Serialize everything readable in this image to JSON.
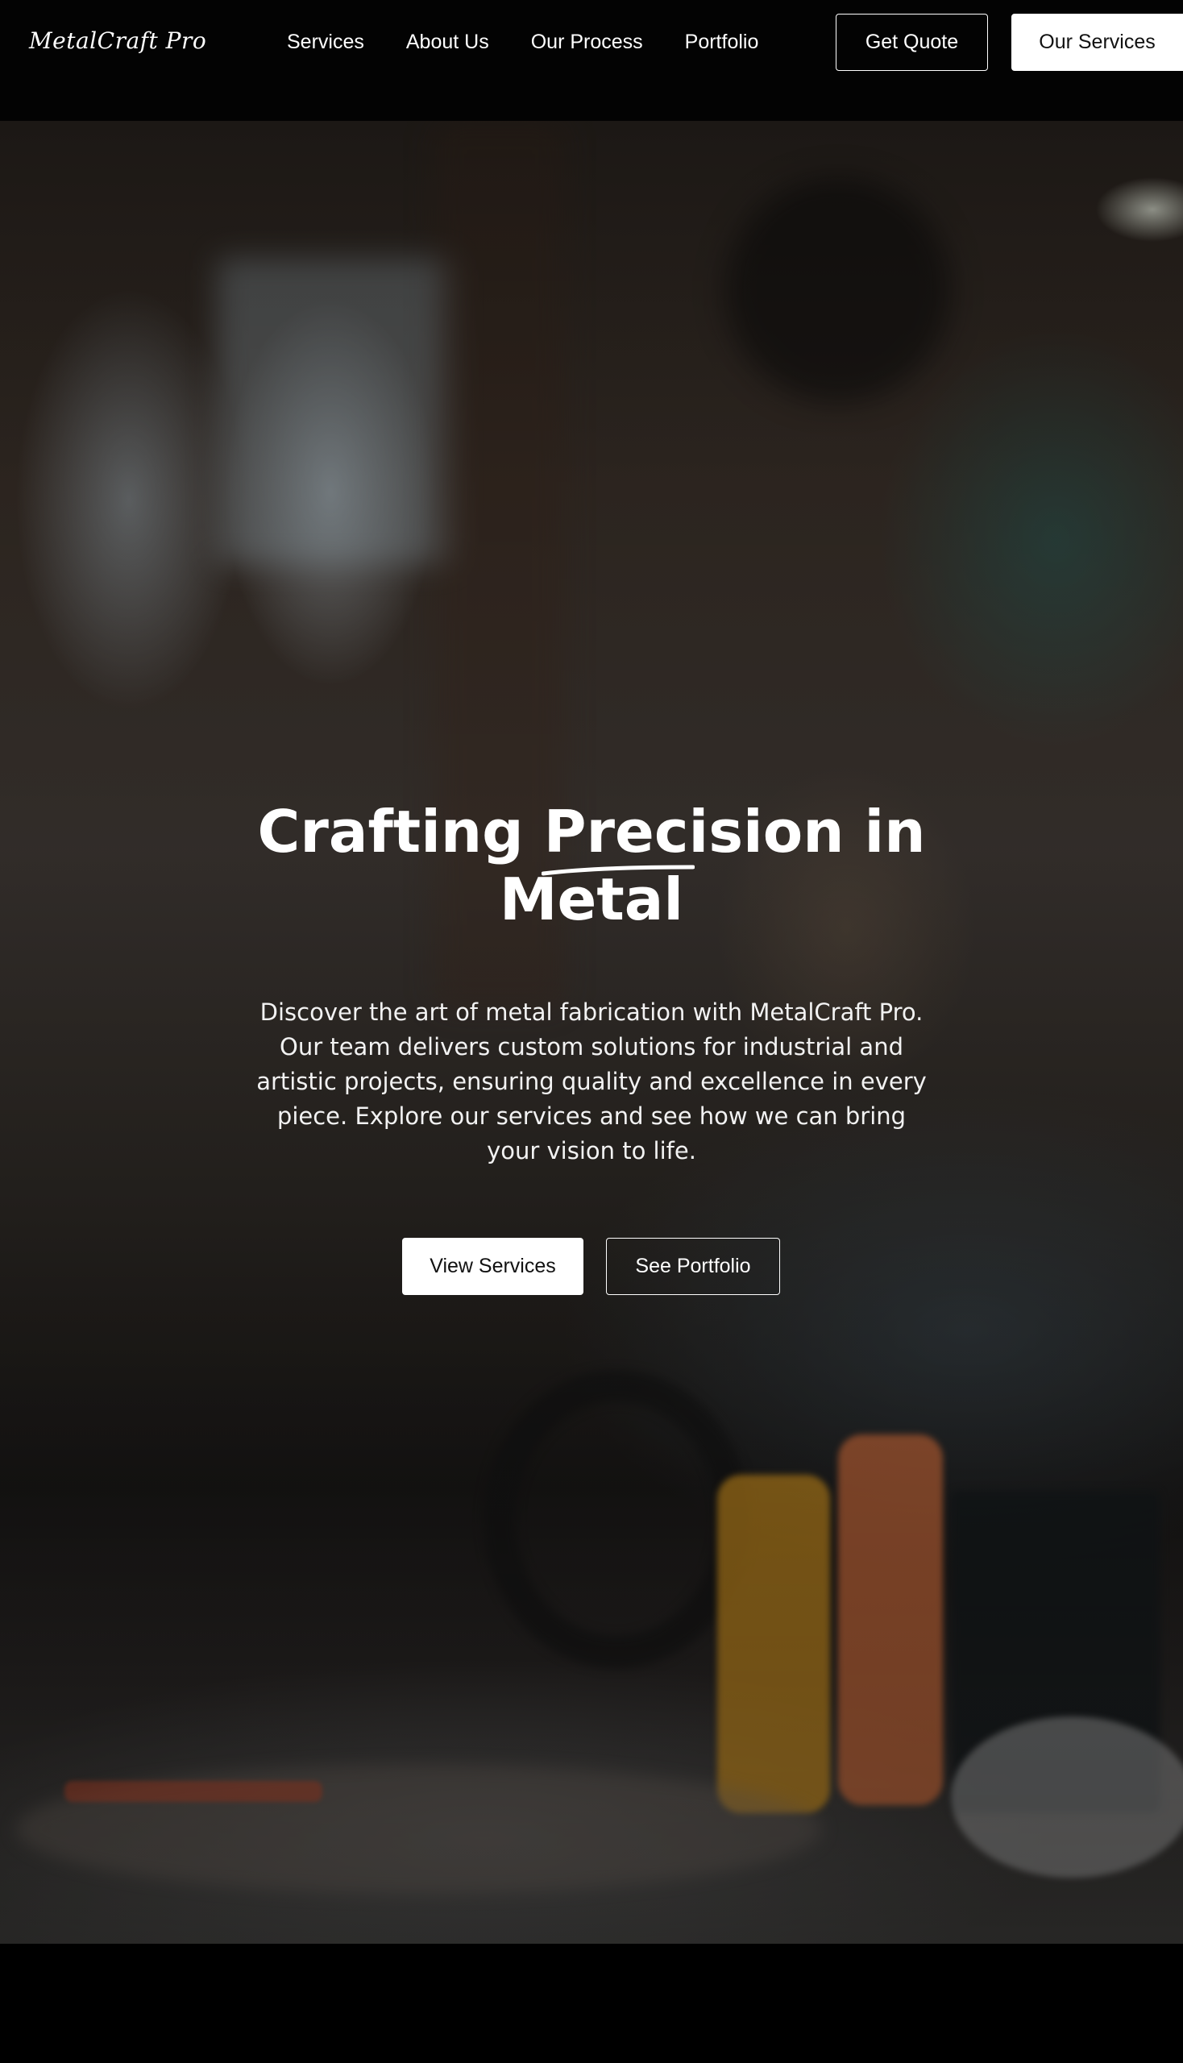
{
  "brand": {
    "name": "MetalCraft Pro"
  },
  "nav": {
    "links": [
      "Services",
      "About Us",
      "Our Process",
      "Portfolio"
    ],
    "get_quote_label": "Get Quote",
    "our_services_label": "Our Services"
  },
  "hero": {
    "title": "Crafting Precision in Metal",
    "description": "Discover the art of metal fabrication with MetalCraft Pro. Our team delivers custom solutions for industrial and artistic projects, ensuring quality and excellence in every piece. Explore our services and see how we can bring your vision to life.",
    "primary_button": "View Services",
    "secondary_button": "See Portfolio"
  },
  "colors": {
    "background": "#000000",
    "text": "#ffffff",
    "button_solid": "#ffffff",
    "button_solid_text": "#111111"
  }
}
